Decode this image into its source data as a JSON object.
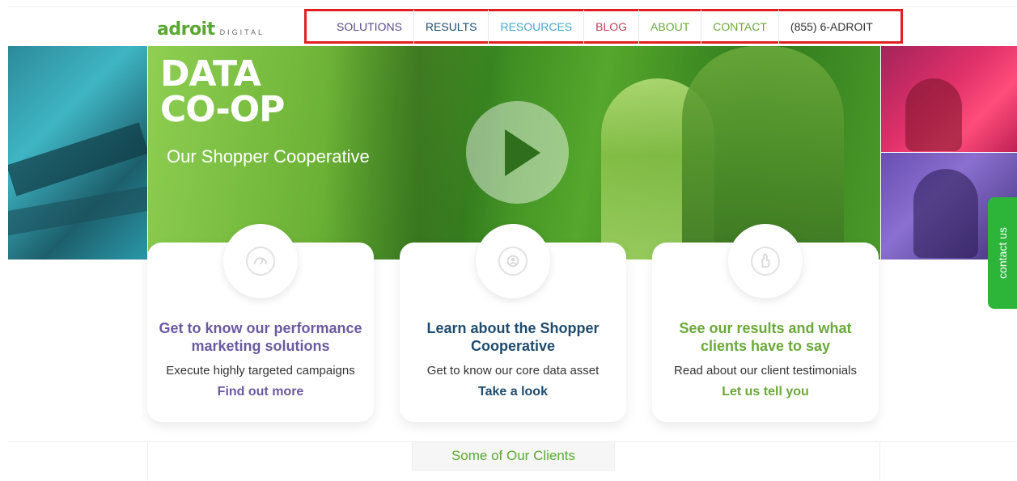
{
  "header": {
    "logo_main": "adroit",
    "logo_sub": "DIGITAL",
    "nav": [
      {
        "label": "SOLUTIONS",
        "color": "#5b4a8a"
      },
      {
        "label": "RESULTS",
        "color": "#1f4b6e"
      },
      {
        "label": "RESOURCES",
        "color": "#47a6c8"
      },
      {
        "label": "BLOG",
        "color": "#c63b5a"
      },
      {
        "label": "ABOUT",
        "color": "#6aa83a"
      },
      {
        "label": "CONTACT",
        "color": "#6aa83a"
      },
      {
        "label": "(855) 6-ADROIT",
        "color": "#333333"
      }
    ]
  },
  "hero": {
    "title_line1": "DATA",
    "title_line2": "CO-OP",
    "subtitle": "Our Shopper Cooperative",
    "play_icon": "play-icon"
  },
  "contact_tab": {
    "label": "contact us",
    "color": "#2db53a"
  },
  "cards": [
    {
      "icon": "gauge-icon",
      "title": "Get to know our performance marketing solutions",
      "description": "Execute highly targeted campaigns",
      "link": "Find out more",
      "color": "#6a5aa0"
    },
    {
      "icon": "shopper-icon",
      "title": "Learn about the Shopper Cooperative",
      "description": "Get to know our core data asset",
      "link": "Take a look",
      "color": "#1f4b6e"
    },
    {
      "icon": "hand-icon",
      "title": "See our results and what clients have to say",
      "description": "Read about our client testimonials",
      "link": "Let us tell you",
      "color": "#6aa83a"
    }
  ],
  "clients": {
    "heading": "Some of Our Clients"
  }
}
